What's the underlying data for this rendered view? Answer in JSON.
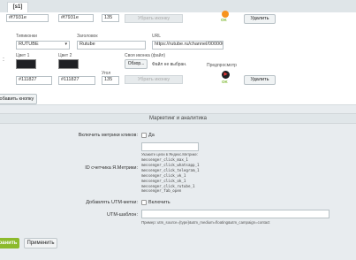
{
  "tab_label": "[s1]",
  "row1": {
    "color1": "#f7931e",
    "color2": "#f7931e",
    "angle": "135",
    "remove_icon_label": "Убрать иконку",
    "ok_label": "OK",
    "delete_label": "Удалить"
  },
  "row2": {
    "type_label": "Типиконки",
    "type_value": "RUTUBE",
    "title_label": "Заголовок",
    "title_value": "Rutube",
    "url_label": "URL",
    "url_value": "https://rutube.ru/channel/000000",
    "color1_label": "Цвет 1",
    "color2_label": "Цвет 2",
    "own_icon_label": "Своя иконка (файл)",
    "browse_label": "Обзор...",
    "file_status": "Файл не выбран.",
    "preview_label": "Предпросмотр",
    "angle_label": "Угол",
    "color1": "#111827",
    "color2": "#111827",
    "angle": "135",
    "remove_icon_label": "Убрать иконку",
    "ok_label": "OK",
    "delete_label": "Удалить",
    "handle": ":"
  },
  "add_button_label": "Добавить кнопку",
  "marketing": {
    "section_title": "Маркетинг и аналитика",
    "metrics_label": "Включить метрики кликов:",
    "metrics_check_label": "Да",
    "counter_label": "ID счетчика Я.Метрики:",
    "goals_hint": "Укажите цели в Яндекс.Метрике:",
    "goals": [
      "messenger_click_max_1",
      "messenger_click_whatsapp_1",
      "messenger_click_telegram_1",
      "messenger_click_vk_1",
      "messenger_click_ok_1",
      "messenger_click_rutube_1",
      "messenger_fab_open"
    ],
    "utm_enable_label": "Добавлять UTM-метки:",
    "utm_enable_check_label": "Включить",
    "utm_template_label": "UTM-шаблон:",
    "utm_example": "Пример: utm_source={type}&utm_medium=floating&utm_campaign=contact"
  },
  "footer": {
    "save_label": "ранить",
    "apply_label": "Применить"
  },
  "colors": {
    "accent_green": "#8cba2c",
    "ok_green": "#7cb82f",
    "swatch_dark": "#1f2024"
  }
}
